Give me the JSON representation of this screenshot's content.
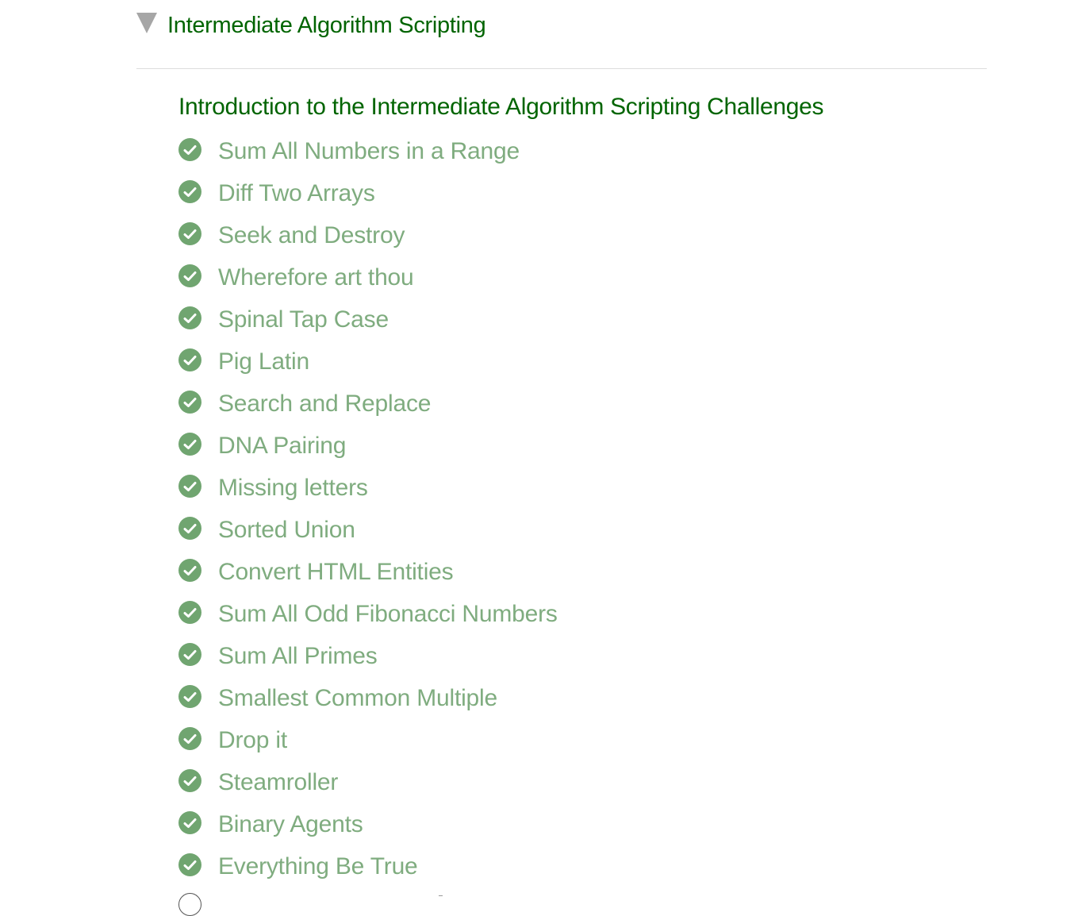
{
  "block": {
    "title": "Intermediate Algorithm Scripting",
    "caret_icon": "triangle-down-icon",
    "expanded": true
  },
  "intro": {
    "label": "Introduction to the Intermediate Algorithm Scripting Challenges"
  },
  "challenges": [
    {
      "label": "Sum All Numbers in a Range",
      "completed": true
    },
    {
      "label": "Diff Two Arrays",
      "completed": true
    },
    {
      "label": "Seek and Destroy",
      "completed": true
    },
    {
      "label": "Wherefore art thou",
      "completed": true
    },
    {
      "label": "Spinal Tap Case",
      "completed": true
    },
    {
      "label": "Pig Latin",
      "completed": true
    },
    {
      "label": "Search and Replace",
      "completed": true
    },
    {
      "label": "DNA Pairing",
      "completed": true
    },
    {
      "label": "Missing letters",
      "completed": true
    },
    {
      "label": "Sorted Union",
      "completed": true
    },
    {
      "label": "Convert HTML Entities",
      "completed": true
    },
    {
      "label": "Sum All Odd Fibonacci Numbers",
      "completed": true
    },
    {
      "label": "Sum All Primes",
      "completed": true
    },
    {
      "label": "Smallest Common Multiple",
      "completed": true
    },
    {
      "label": "Drop it",
      "completed": true
    },
    {
      "label": "Steamroller",
      "completed": true
    },
    {
      "label": "Binary Agents",
      "completed": true
    },
    {
      "label": "Everything Be True",
      "completed": true
    }
  ],
  "colors": {
    "title_green": "#006400",
    "completed_text": "#7fac7f",
    "check_fill": "#70a570",
    "caret": "#a6a6a6",
    "divider": "#dddddd"
  },
  "icons": {
    "completed": "check-circle-icon",
    "incomplete": "empty-circle-icon"
  }
}
